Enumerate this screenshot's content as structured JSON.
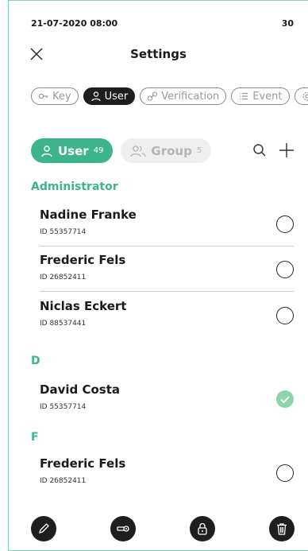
{
  "status": {
    "datetime": "21-07-2020 08:00",
    "right_value": "30"
  },
  "header": {
    "title": "Settings"
  },
  "chips": [
    {
      "label": "Key",
      "icon": "key-icon",
      "active": false
    },
    {
      "label": "User",
      "icon": "user-icon",
      "active": true
    },
    {
      "label": "Verification",
      "icon": "link-icon",
      "active": false
    },
    {
      "label": "Event",
      "icon": "list-icon",
      "active": false
    },
    {
      "label": "",
      "icon": "gear-icon",
      "active": false
    }
  ],
  "segments": {
    "user": {
      "label": "User",
      "count": "49"
    },
    "group": {
      "label": "Group",
      "count": "5"
    }
  },
  "sections": [
    {
      "title": "Administrator",
      "rows": [
        {
          "name": "Nadine Franke",
          "id": "ID 55357714",
          "selected": false
        },
        {
          "name": "Frederic Fels",
          "id": "ID 26852411",
          "selected": false
        },
        {
          "name": "Niclas Eckert",
          "id": "ID 88537441",
          "selected": false
        }
      ]
    },
    {
      "title": "D",
      "rows": [
        {
          "name": "David Costa",
          "id": "ID 55357714",
          "selected": true
        }
      ]
    },
    {
      "title": "F",
      "rows": [
        {
          "name": "Frederic Fels",
          "id": "ID 26852411",
          "selected": false
        }
      ]
    }
  ],
  "colors": {
    "accent": "#3db48c",
    "dark": "#1e1e1e",
    "check": "#8dd4aa"
  },
  "bottom_actions": [
    "pencil-icon",
    "key-icon",
    "lock-icon",
    "trash-icon"
  ]
}
